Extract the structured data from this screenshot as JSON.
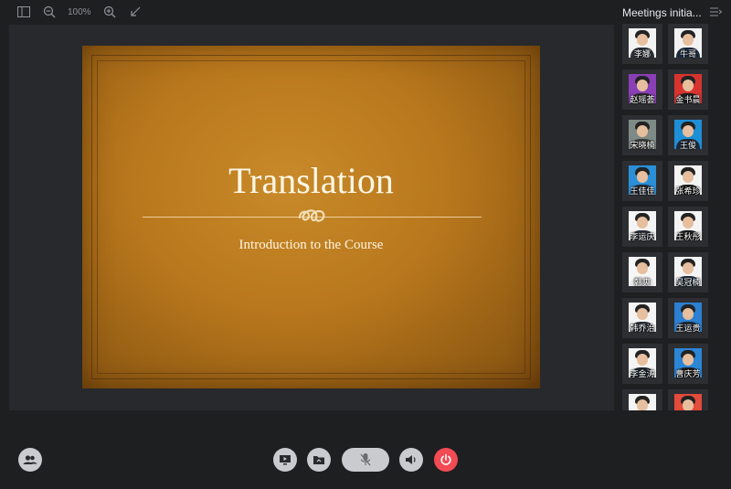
{
  "toolbar": {
    "zoom_level": "100%",
    "icons": [
      "sidebar-toggle-icon",
      "zoom-out-icon",
      "zoom-in-icon",
      "exit-fullscreen-icon"
    ]
  },
  "slide": {
    "title": "Translation",
    "subtitle": "Introduction to the Course",
    "colors": {
      "background": "#b8771c",
      "text": "#fff7e6"
    }
  },
  "participants_panel": {
    "title": "Meetings initia...",
    "participants": [
      {
        "name": "李娜",
        "bg": "#f2f2f2",
        "shirt": "#2a2f3a"
      },
      {
        "name": "牛哥",
        "bg": "#f2f2f2",
        "shirt": "#1c2b3f"
      },
      {
        "name": "赵瑶荟",
        "bg": "#8a3fb6",
        "shirt": "#2a2a2a"
      },
      {
        "name": "金书晨",
        "bg": "#d7342f",
        "shirt": "#1f1f1f"
      },
      {
        "name": "宋晓楠",
        "bg": "#7e8a86",
        "shirt": "#3c3f3b"
      },
      {
        "name": "王俊",
        "bg": "#1e8fd6",
        "shirt": "#1f2a38"
      },
      {
        "name": "王佳佳",
        "bg": "#2a8fd6",
        "shirt": "#232a34"
      },
      {
        "name": "张希珍",
        "bg": "#f4f4f4",
        "shirt": "#1d1d1d"
      },
      {
        "name": "李运庆",
        "bg": "#f4f4f4",
        "shirt": "#2b2f36"
      },
      {
        "name": "王秋彤",
        "bg": "#f4f4f4",
        "shirt": "#1e1e1e"
      },
      {
        "name": "韩爽",
        "bg": "#f6f6f6",
        "shirt": "#e7e7e7"
      },
      {
        "name": "吴冠楠",
        "bg": "#f4f4f4",
        "shirt": "#263040"
      },
      {
        "name": "韩乔治",
        "bg": "#f4f4f4",
        "shirt": "#2a2f39"
      },
      {
        "name": "王运贵",
        "bg": "#2c7fd1",
        "shirt": "#1f2833"
      },
      {
        "name": "李金涛",
        "bg": "#f4f4f4",
        "shirt": "#222831"
      },
      {
        "name": "曹庆芳",
        "bg": "#2b86d6",
        "shirt": "#1f1f1f"
      },
      {
        "name": "",
        "bg": "#f4f4f4",
        "shirt": "#2a2f3a"
      },
      {
        "name": "",
        "bg": "#e34b3a",
        "shirt": "#1f1f1f"
      }
    ]
  },
  "controls": {
    "participants_icon": "participants-icon",
    "buttons": [
      "share-screen-icon",
      "share-file-icon",
      "mute-microphone-icon",
      "speaker-volume-icon",
      "end-meeting-icon"
    ],
    "end_color": "#f24b54"
  }
}
